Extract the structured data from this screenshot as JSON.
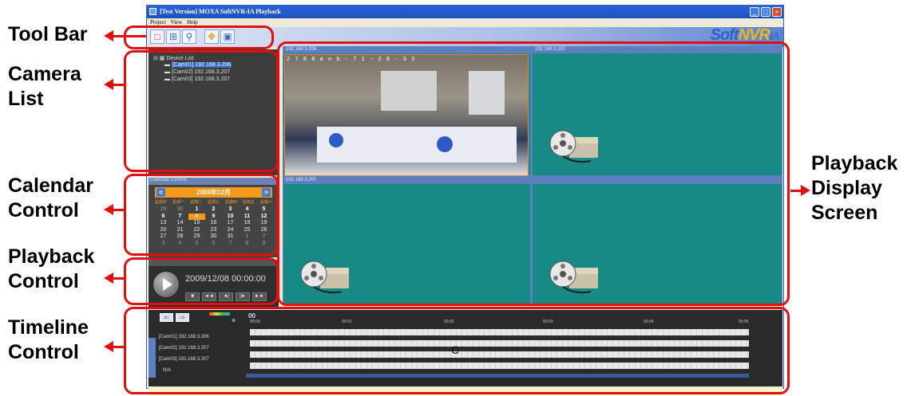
{
  "annotations": {
    "toolbar": [
      "Tool Bar"
    ],
    "camera_list": [
      "Camera",
      "List"
    ],
    "calendar_control": [
      "Calendar",
      "Control"
    ],
    "playback_control": [
      "Playback",
      "Control"
    ],
    "timeline_control": [
      "Timeline",
      "Control"
    ],
    "playback_display": [
      "Playback",
      "Display",
      "Screen"
    ]
  },
  "window": {
    "title": "[Test Version] MOXA SoftNVR-IA Playback",
    "menu": [
      "Project",
      "View",
      "Help"
    ],
    "brand_soft": "Soft",
    "brand_nvr": "NVR",
    "brand_ia": "IA"
  },
  "device_list": {
    "root": "Device List",
    "cameras": [
      "[Cam01] 192.168.3.206",
      "[Cam02] 192.168.3.207",
      "[Cam03] 192.168.3.207"
    ]
  },
  "calendar": {
    "header": "Calendar Control",
    "month": "2009年12月",
    "dow": [
      "星期日",
      "星期一",
      "星期二",
      "星期三",
      "星期四",
      "星期五",
      "星期六"
    ],
    "days": [
      [
        "29",
        "30",
        "1",
        "2",
        "3",
        "4",
        "5"
      ],
      [
        "6",
        "7",
        "8",
        "9",
        "10",
        "11",
        "12"
      ],
      [
        "13",
        "14",
        "15",
        "16",
        "17",
        "18",
        "19"
      ],
      [
        "20",
        "21",
        "22",
        "23",
        "24",
        "25",
        "26"
      ],
      [
        "27",
        "28",
        "29",
        "30",
        "31",
        "1",
        "2"
      ],
      [
        "3",
        "4",
        "5",
        "6",
        "7",
        "8",
        "9"
      ]
    ]
  },
  "playback": {
    "time": "2009/12/08 00:00:00",
    "buttons": [
      "■",
      "◄◄",
      "◄|",
      "|►",
      "►►"
    ]
  },
  "display": {
    "cells": [
      {
        "label": "192.168.3.206",
        "timestamp": "2 7 8 8 a n b - 7 1 - 2 8 - 3 3"
      },
      {
        "label": "192.168.3.207"
      },
      {
        "label": "192.168.3.207"
      },
      {
        "label": ""
      }
    ]
  },
  "timeline": {
    "side_label": "Timeline Control",
    "zoom": "00",
    "ticks": [
      "00:00",
      "00:01",
      "00:02",
      "00:03",
      "00:04",
      "00:05"
    ],
    "rows": [
      "[Cam01] 192.168.3.206",
      "[Cam02] 192.168.3.207",
      "[Cam03] 192.168.3.207",
      "N/A"
    ],
    "marker": "C"
  }
}
